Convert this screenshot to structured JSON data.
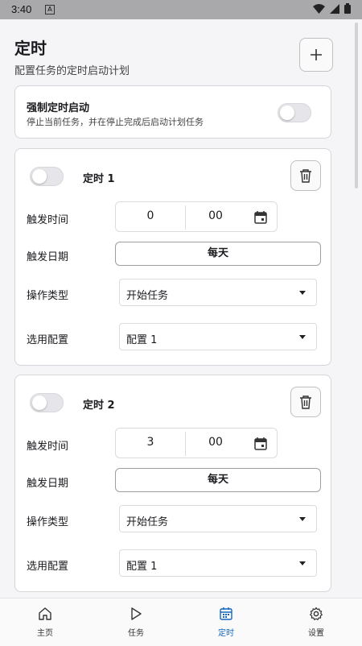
{
  "status_bar": {
    "time": "3:40",
    "notif_glyph": "A"
  },
  "header": {
    "title": "定时",
    "subtitle": "配置任务的定时启动计划",
    "add_icon": "plus-icon"
  },
  "force_start": {
    "title": "强制定时启动",
    "description": "停止当前任务，并在停止完成后启动计划任务",
    "enabled": false
  },
  "labels": {
    "trigger_time": "触发时间",
    "trigger_date": "触发日期",
    "action_type": "操作类型",
    "config": "选用配置"
  },
  "timers": [
    {
      "name": "定时 1",
      "enabled": false,
      "hour": "0",
      "minute": "00",
      "date": "每天",
      "action": "开始任务",
      "config": "配置 1"
    },
    {
      "name": "定时 2",
      "enabled": false,
      "hour": "3",
      "minute": "00",
      "date": "每天",
      "action": "开始任务",
      "config": "配置 1"
    }
  ],
  "nav": [
    {
      "label": "主页",
      "icon": "home-icon",
      "active": false
    },
    {
      "label": "任务",
      "icon": "play-icon",
      "active": false
    },
    {
      "label": "定时",
      "icon": "calendar-icon",
      "active": true
    },
    {
      "label": "设置",
      "icon": "gear-icon",
      "active": false
    }
  ],
  "colors": {
    "accent": "#1565c0",
    "status_bar": "#a9a9ab"
  }
}
